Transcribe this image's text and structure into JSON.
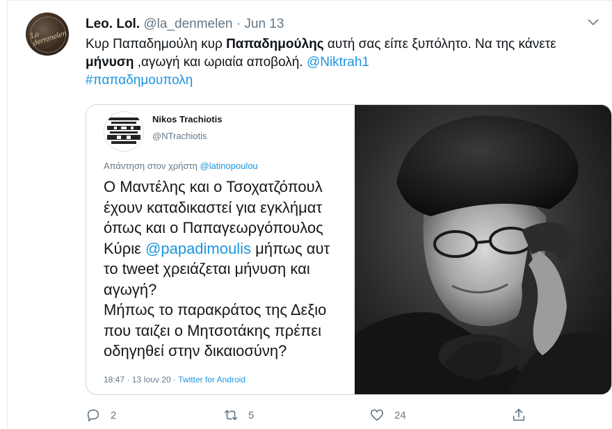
{
  "tweet": {
    "author_name": "Leo. Lol.",
    "author_handle": "@la_denmelen",
    "separator": "·",
    "date": "Jun 13",
    "avatar_text": "Lo dernmelen",
    "text_1": "Κυρ Παπαδημούλη κυρ ",
    "text_bold_1": "Παπαδημούλης",
    "text_2": " αυτή σας είπε ξυπόλητο. Να της κάνετε ",
    "text_bold_2": "μήνυση",
    "text_3": " ,αγωγή και ωριαία αποβολή. ",
    "mention": "@Niktrah1",
    "hashtag": "#παπαδημουπολη"
  },
  "quote": {
    "author_name": "Nikos Trachiotis",
    "author_handle": "@NTrachiotis",
    "reply_prefix": "Απάντηση στον χρήστη ",
    "reply_handle": "@latinopoulou",
    "lines": {
      "l1": "Ο Μαντέλης και ο Τσοχατζόπουλ",
      "l2": "έχουν καταδικαστεί για εγκλήματ",
      "l3": "όπως και ο Παπαγεωργόπουλος",
      "l4a": "Κύριε ",
      "l4_mention": "@papadimoulis",
      "l4b": " μήπως αυτ",
      "l5": "το tweet χρειάζεται μήνυση και",
      "l6": "αγωγή?",
      "l7": "Μήπως το παρακράτος της Δεξιο",
      "l8": "που ταιζει ο Μητσοτάκης πρέπει",
      "l9": "οδηγηθεί στην δικαιοσύνη?"
    },
    "footer_time": "18:47 · 13 Ιουν 20 · ",
    "footer_source": "Twitter for Android",
    "photo_icon": "man-on-telephone-photo"
  },
  "actions": {
    "reply_count": "2",
    "retweet_count": "5",
    "like_count": "24"
  },
  "colors": {
    "link": "#1b95e0",
    "secondary": "#657786",
    "border": "#ccd6dd"
  }
}
